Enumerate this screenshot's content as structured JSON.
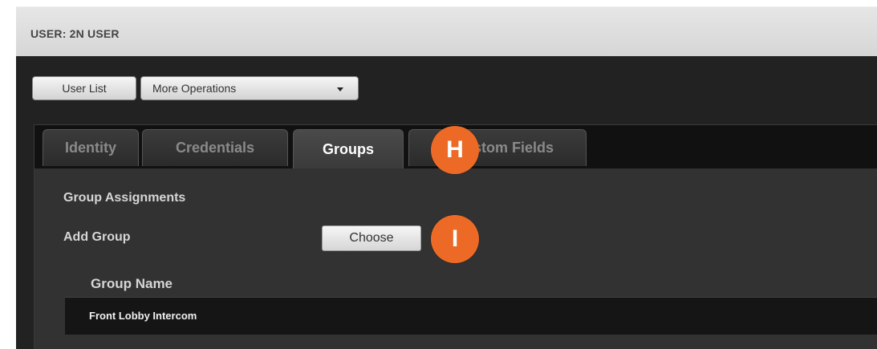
{
  "header": {
    "title": "USER: 2N USER"
  },
  "toolbar": {
    "user_list_label": "User List",
    "more_operations_label": "More Operations"
  },
  "tabs": [
    {
      "label": "Identity",
      "active": false
    },
    {
      "label": "Credentials",
      "active": false
    },
    {
      "label": "Groups",
      "active": true
    },
    {
      "label": "stom Fields",
      "active": false
    }
  ],
  "groups_panel": {
    "section_title": "Group Assignments",
    "add_group_label": "Add Group",
    "choose_button_label": "Choose",
    "column_header": "Group Name",
    "rows": [
      {
        "group_name": "Front Lobby Intercom"
      }
    ]
  },
  "callouts": [
    {
      "label": "H"
    },
    {
      "label": "I"
    }
  ],
  "colors": {
    "accent_orange": "#ec6a26",
    "panel_dark": "#222222",
    "content_bg": "#323232"
  }
}
